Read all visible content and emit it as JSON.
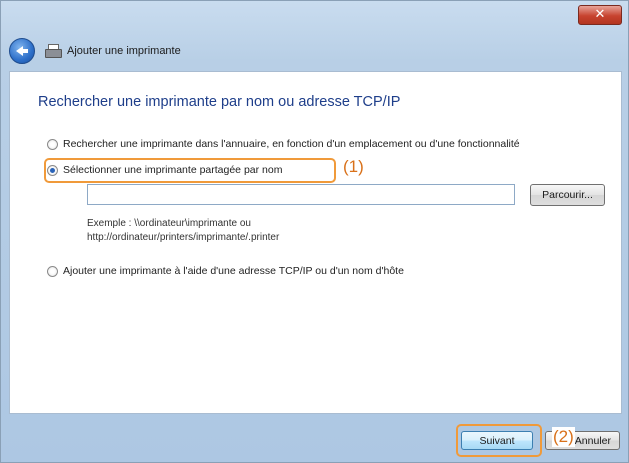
{
  "window": {
    "title": "Ajouter une imprimante",
    "close_glyph": "✕"
  },
  "page": {
    "heading": "Rechercher une imprimante par nom ou adresse TCP/IP"
  },
  "options": [
    {
      "label": "Rechercher une imprimante dans l'annuaire, en fonction d'un emplacement ou d'une fonctionnalité",
      "selected": false
    },
    {
      "label": "Sélectionner une imprimante partagée par nom",
      "selected": true
    },
    {
      "label": "Ajouter une imprimante à l'aide d'une adresse TCP/IP ou d'un nom d'hôte",
      "selected": false
    }
  ],
  "shared_name": {
    "value": "",
    "browse_label": "Parcourir...",
    "example_line1": "Exemple : \\\\ordinateur\\imprimante ou",
    "example_line2": "http://ordinateur/printers/imprimante/.printer"
  },
  "footer": {
    "next_label": "Suivant",
    "cancel_label": "Annuler"
  },
  "annotations": {
    "marker1": "(1)",
    "marker2": "(2)",
    "accent_color": "#f09a3a"
  }
}
